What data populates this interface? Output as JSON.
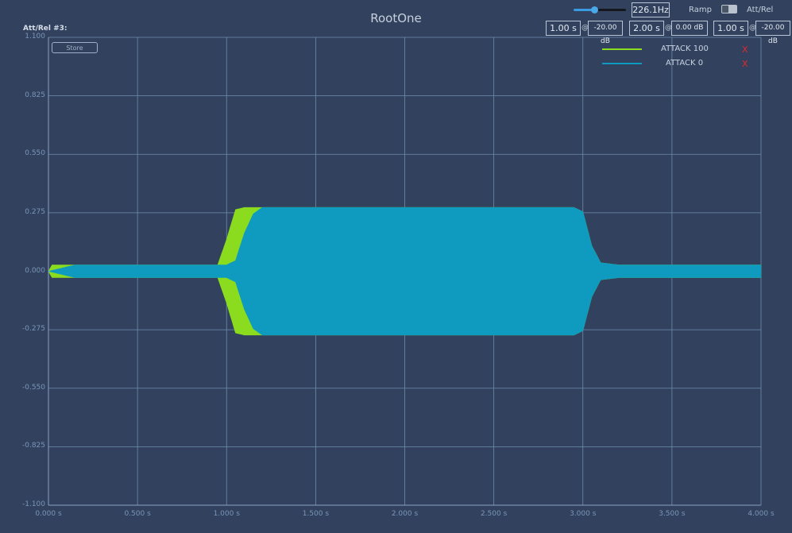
{
  "app": {
    "title": "RootOne",
    "sublabel": "Att/Rel #3:"
  },
  "toolbar": {
    "frequency": "226.1Hz",
    "frequency_slider_fraction": 0.4,
    "ramp_label": "Ramp",
    "attrel_label": "Att/Rel",
    "attack_time": "1.00 s",
    "attack_level": "-20.00 dB",
    "hold_time": "2.00 s",
    "hold_level": "0.00 dB",
    "release_time": "1.00 s",
    "release_level": "-20.00 dB",
    "at_symbol": "@"
  },
  "store_button": {
    "label": "Store"
  },
  "legend": [
    {
      "label": "ATTACK 100",
      "color": "#8bdc1e",
      "remove": "X"
    },
    {
      "label": "ATTACK 0",
      "color": "#0e9bbf",
      "remove": "X"
    }
  ],
  "chart_data": {
    "type": "area",
    "xlabel": "",
    "ylabel": "",
    "xlim": [
      0,
      4.0
    ],
    "ylim": [
      -1.1,
      1.1
    ],
    "x_ticks": [
      "0.000 s",
      "0.500 s",
      "1.000 s",
      "1.500 s",
      "2.000 s",
      "2.500 s",
      "3.000 s",
      "3.500 s",
      "4.000 s"
    ],
    "y_ticks": [
      "1.100",
      "0.825",
      "0.550",
      "0.275",
      "0.000",
      "-0.275",
      "-0.550",
      "-0.825",
      "-1.100"
    ],
    "grid": true,
    "legend_position": "top-right",
    "series": [
      {
        "name": "ATTACK 100",
        "color": "#8bdc1e",
        "envelope": [
          [
            0,
            0
          ],
          [
            0.02,
            0.03
          ],
          [
            0.08,
            0.03
          ],
          [
            0.95,
            0.03
          ],
          [
            1.0,
            0.15
          ],
          [
            1.05,
            0.29
          ],
          [
            1.1,
            0.3
          ],
          [
            2.95,
            0.3
          ],
          [
            3.0,
            0.28
          ],
          [
            3.05,
            0.12
          ],
          [
            3.1,
            0.04
          ],
          [
            3.2,
            0.03
          ],
          [
            4.0,
            0.03
          ]
        ]
      },
      {
        "name": "ATTACK 0",
        "color": "#0e9bbf",
        "envelope": [
          [
            0,
            0
          ],
          [
            0.15,
            0.03
          ],
          [
            1.0,
            0.03
          ],
          [
            1.05,
            0.05
          ],
          [
            1.1,
            0.18
          ],
          [
            1.15,
            0.27
          ],
          [
            1.2,
            0.3
          ],
          [
            2.95,
            0.3
          ],
          [
            3.0,
            0.28
          ],
          [
            3.05,
            0.12
          ],
          [
            3.1,
            0.04
          ],
          [
            3.2,
            0.03
          ],
          [
            4.0,
            0.03
          ]
        ]
      }
    ]
  }
}
